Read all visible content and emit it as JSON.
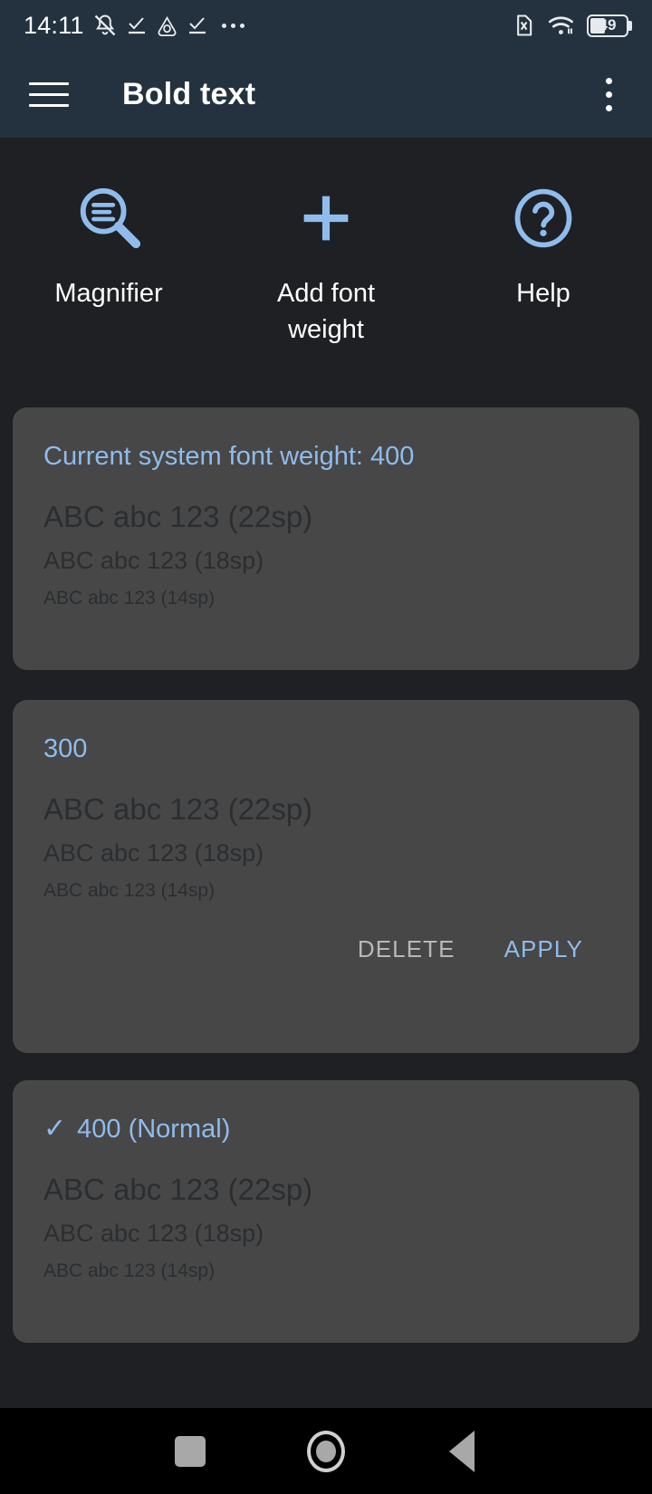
{
  "status_bar": {
    "clock": "14:11",
    "left_icons": [
      "bell-muted-icon",
      "check-underline-icon",
      "triangle-drop-icon",
      "check-underline-icon",
      "more-dots-icon"
    ],
    "right_icons": [
      "sim-card-error-icon",
      "wifi-icon",
      "battery-icon"
    ],
    "battery_level": "49"
  },
  "app_bar": {
    "menu_icon": "hamburger-menu-icon",
    "title": "Bold text",
    "overflow_icon": "more-vert-icon"
  },
  "actions": [
    {
      "label": "Magnifier",
      "icon": "magnifier-text-icon"
    },
    {
      "label": "Add font weight",
      "icon": "plus-icon"
    },
    {
      "label": "Help",
      "icon": "help-circle-icon"
    }
  ],
  "cards": [
    {
      "title": "Current system font weight: 400",
      "checked": false,
      "check_glyph": "",
      "samples": [
        "ABC abc 123 (22sp)",
        "ABC abc 123 (18sp)",
        "ABC abc 123 (14sp)"
      ],
      "has_actions": false,
      "delete_label": "",
      "apply_label": ""
    },
    {
      "title": "300",
      "checked": false,
      "check_glyph": "",
      "samples": [
        "ABC abc 123 (22sp)",
        "ABC abc 123 (18sp)",
        "ABC abc 123 (14sp)"
      ],
      "has_actions": true,
      "delete_label": "DELETE",
      "apply_label": "APPLY"
    },
    {
      "title": "400 (Normal)",
      "checked": true,
      "check_glyph": "✓",
      "samples": [
        "ABC abc 123 (22sp)",
        "ABC abc 123 (18sp)",
        "ABC abc 123 (14sp)"
      ],
      "has_actions": false,
      "delete_label": "",
      "apply_label": ""
    }
  ],
  "nav_bar": {
    "recents": "recents-square-icon",
    "home": "home-circle-icon",
    "back": "back-triangle-icon"
  },
  "colors": {
    "accent_blue": "#8fbcec",
    "app_bar_bg": "#24323f",
    "page_bg": "#1e2023",
    "card_bg": "#474747",
    "sample_text": "#2b2e31",
    "nav_bg": "#000000"
  }
}
